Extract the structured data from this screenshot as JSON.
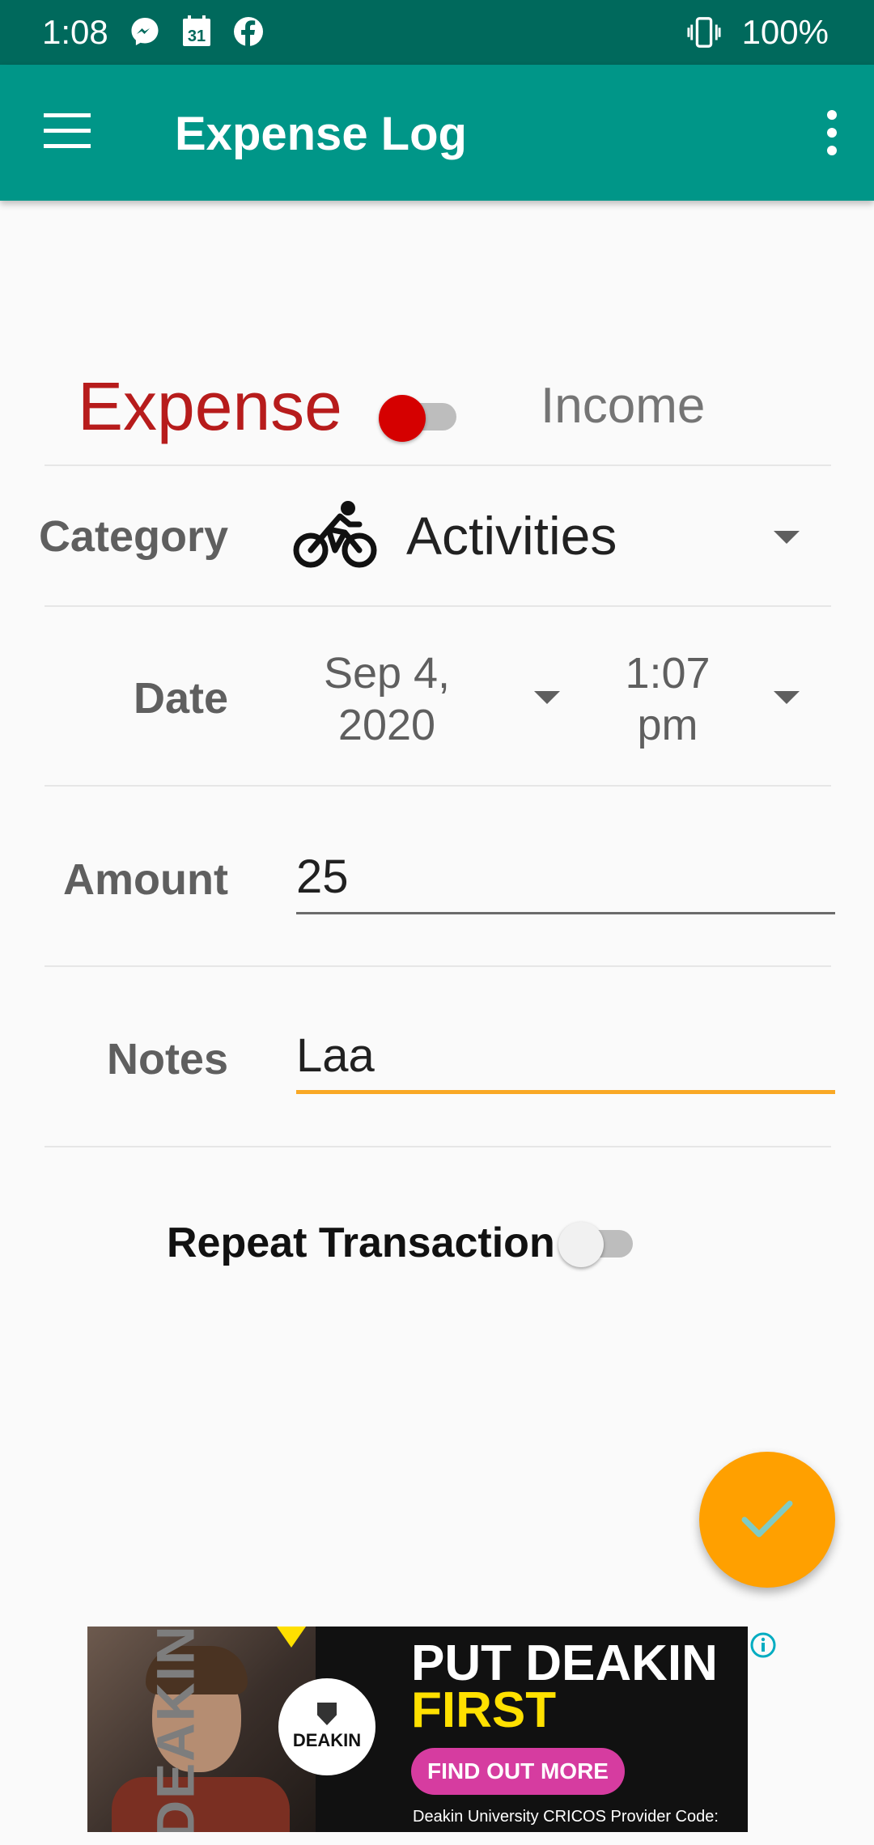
{
  "status_bar": {
    "time": "1:08",
    "battery": "100%",
    "calendar_day": "31",
    "icons": [
      "messenger-icon",
      "calendar-icon",
      "facebook-icon",
      "vibrate-icon"
    ]
  },
  "app_bar": {
    "title": "Expense Log",
    "color": "#009688"
  },
  "transaction_type": {
    "expense_label": "Expense",
    "income_label": "Income",
    "selected": "Expense",
    "expense_color": "#b71c1c"
  },
  "form": {
    "category_label": "Category",
    "category_value": "Activities",
    "category_icon": "bike-icon",
    "date_label": "Date",
    "date_value": "Sep 4, 2020",
    "time_value": "1:07 pm",
    "amount_label": "Amount",
    "amount_value": "25",
    "notes_label": "Notes",
    "notes_value": "Laa",
    "repeat_label": "Repeat Transaction",
    "repeat_enabled": false
  },
  "fab": {
    "icon": "check-icon",
    "color": "#ffa000"
  },
  "ad": {
    "vertical_text": "DEAKIN",
    "logo_text": "DEAKIN",
    "headline_1": "PUT DEAKIN",
    "headline_2": "FIRST",
    "cta": "FIND OUT MORE",
    "footer": "Deakin University CRICOS Provider Code:",
    "accent_color": "#ffe000",
    "cta_color": "#d63ca0"
  }
}
